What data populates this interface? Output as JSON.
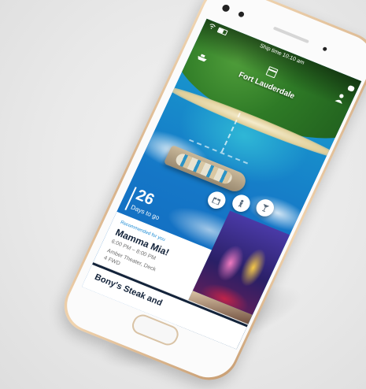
{
  "status": {
    "ship_time": "Ship time 10:10 am"
  },
  "header": {
    "port": "Fort Lauderdale"
  },
  "countdown": {
    "number": "26",
    "label": "Days to go"
  },
  "recommendation": {
    "label": "Recommended for you",
    "title": "Mamma Mia!",
    "time": "6:00 PM – 8:00 PM",
    "venue": "Amber Theater, Deck 4 FWD"
  },
  "next_card": {
    "title": "Bony's Steak and"
  },
  "icons": {
    "wifi": "wifi-icon",
    "battery": "battery-icon",
    "chat": "chat-icon",
    "profile": "profile-icon",
    "calendar": "calendar-icon",
    "ship": "ship-icon",
    "gift": "gift-icon",
    "person_walk": "person-icon",
    "cocktail": "cocktail-icon"
  },
  "colors": {
    "accent_blue": "#1a8ad4",
    "navy": "#13233a",
    "gold_frame": "#d7b189"
  }
}
